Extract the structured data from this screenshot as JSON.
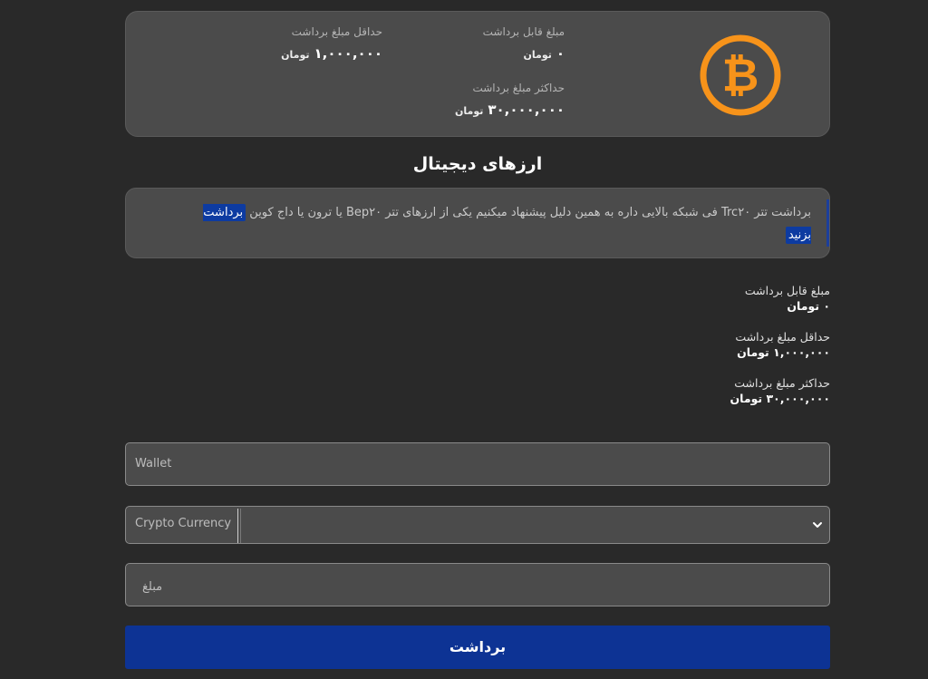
{
  "summary": {
    "withdrawable_label": "مبلغ قابل برداشت",
    "withdrawable_value": "۰",
    "min_label": "حداقل مبلغ برداشت",
    "min_value": "۱,۰۰۰,۰۰۰",
    "max_label": "حداکثر مبلغ برداشت",
    "max_value": "۳۰,۰۰۰,۰۰۰",
    "unit": "تومان"
  },
  "page_title": "ارزهای دیجیتال",
  "notice": {
    "text": "برداشت تتر Trc۲۰ فی شبکه بالایی داره به همین دلیل پیشنهاد میکنیم یکی از ارزهای تتر Bep۲۰ یا ترون یا داج کوین",
    "highlight": "برداشت بزنید"
  },
  "info": {
    "withdrawable_label": "مبلغ قابل برداشت",
    "withdrawable_value": "۰ تومان",
    "min_label": "حداقل مبلغ برداشت",
    "min_value": "۱,۰۰۰,۰۰۰ تومان",
    "max_label": "حداکثر مبلغ برداشت",
    "max_value": "۳۰,۰۰۰,۰۰۰ تومان"
  },
  "form": {
    "wallet_placeholder": "Wallet",
    "crypto_label": "Crypto Currency",
    "crypto_selected": "",
    "amount_placeholder": "مبلغ",
    "submit_label": "برداشت"
  },
  "colors": {
    "background": "#292929",
    "card": "#4b4b4b",
    "accent": "#0d3394",
    "bitcoin": "#f7931a"
  },
  "icons": [
    "bitcoin-icon",
    "chevron-down-icon"
  ]
}
